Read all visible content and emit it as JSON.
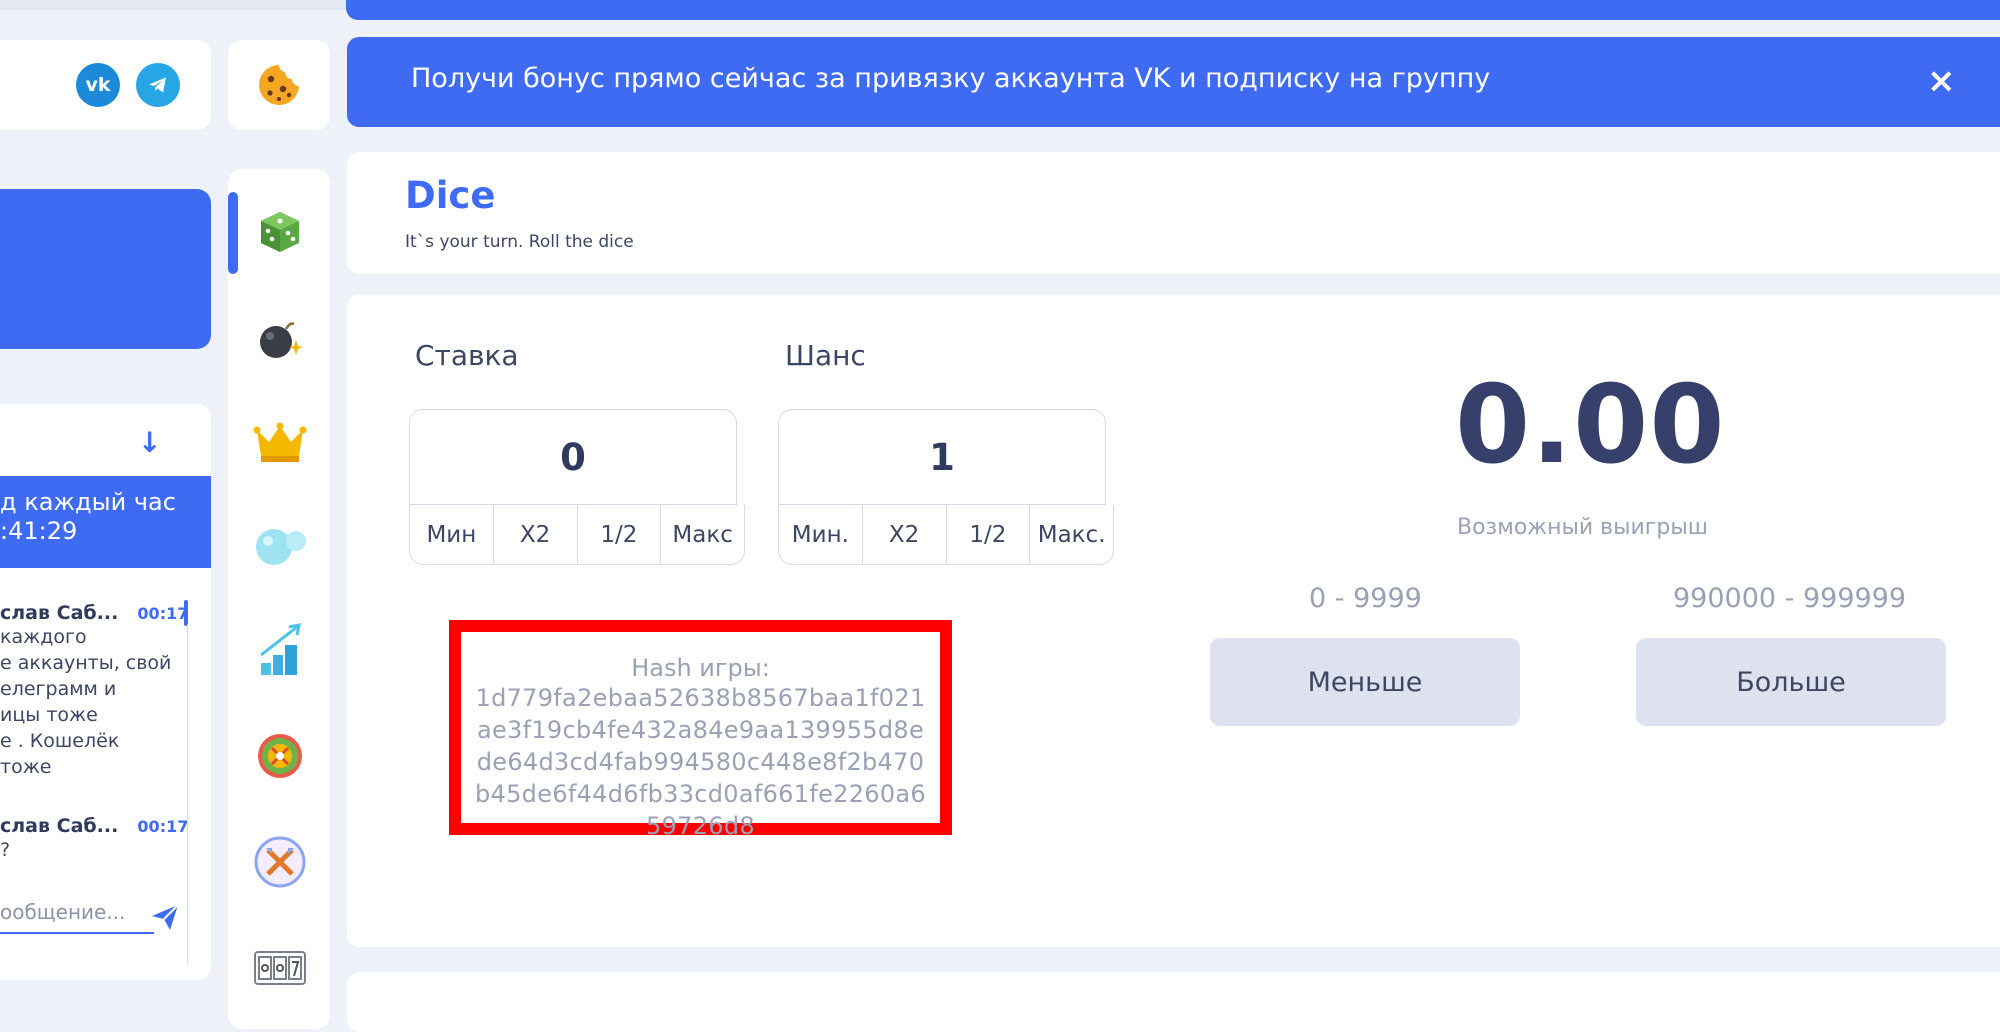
{
  "banner": {
    "text": "Получи бонус прямо сейчас за привязку аккаунта VK и подписку на группу",
    "close": "×"
  },
  "social": {
    "vk_label": "vk",
    "telegram_icon": "telegram-icon"
  },
  "chat": {
    "bonus_line1": "д каждый час",
    "bonus_line2": ":41:29",
    "messages": [
      {
        "author": "слав Саб...",
        "time": "00:17",
        "lines": [
          "каждого",
          "е аккаунты, свой",
          "елеграмм и",
          "ицы тоже",
          "е . Кошелёк",
          " тоже"
        ]
      },
      {
        "author": "слав Саб...",
        "time": "00:17",
        "lines": [
          "?"
        ]
      }
    ],
    "input_placeholder": "ообщение..."
  },
  "nav": {
    "items": [
      "dice-icon",
      "bomb-icon",
      "crown-icon",
      "bubbles-icon",
      "chart-up-icon",
      "wheel-icon",
      "swords-icon",
      "slots-icon"
    ]
  },
  "game": {
    "title": "Dice",
    "subtitle": "It`s your turn. Roll the dice"
  },
  "bet": {
    "label": "Ставка",
    "value": "0",
    "buttons": [
      "Мин",
      "X2",
      "1/2",
      "Макс"
    ]
  },
  "chance": {
    "label": "Шанс",
    "value": "1",
    "buttons": [
      "Мин.",
      "X2",
      "1/2",
      "Макс."
    ]
  },
  "hash": {
    "label": "Hash игры:",
    "value": "1d779fa2ebaa52638b8567baa1f021ae3f19cb4fe432a84e9aa139955d8ede64d3cd4fab994580c448e8f2b470b45de6f44d6fb33cd0af661fe2260a659726d8"
  },
  "win": {
    "value": "0.00",
    "label": "Возможный выигрыш"
  },
  "less": {
    "range": "0 - 9999",
    "button": "Меньше"
  },
  "more": {
    "range": "990000 - 999999",
    "button": "Больше"
  },
  "colors": {
    "accent": "#3e6bf2",
    "highlight_border": "#ff0000",
    "button_bg": "#dde2ee"
  }
}
